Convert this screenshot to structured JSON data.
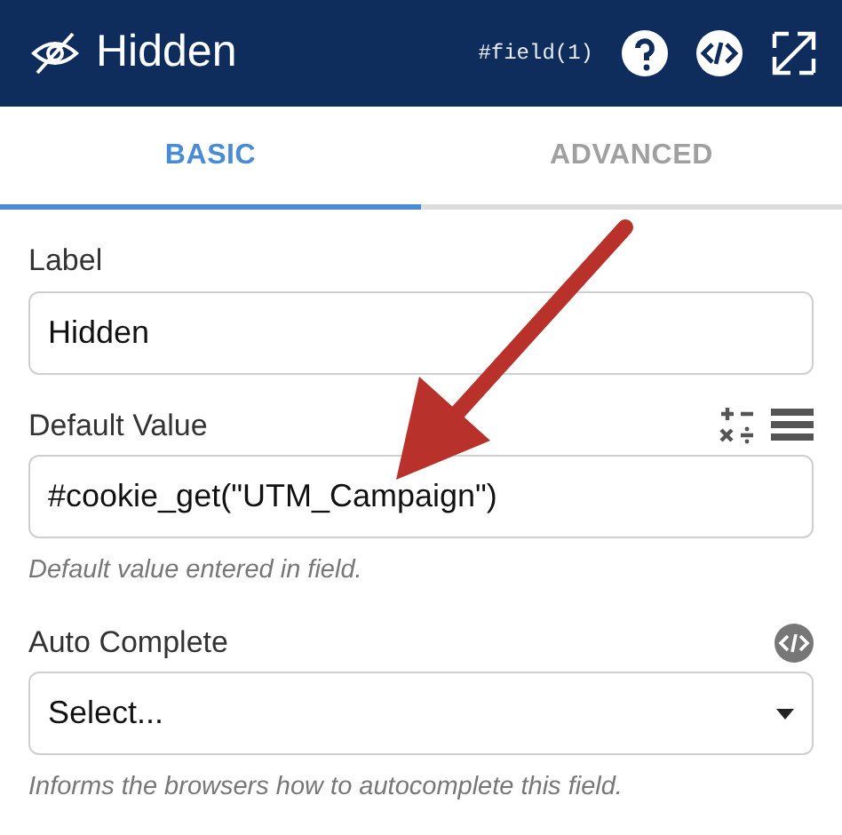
{
  "header": {
    "title": "Hidden",
    "field_ref": "#field(1)"
  },
  "tabs": [
    {
      "label": "BASIC",
      "selected": true
    },
    {
      "label": "ADVANCED",
      "selected": false
    }
  ],
  "fields": [
    {
      "kind": "text",
      "label": "Label",
      "value": "Hidden"
    },
    {
      "kind": "formula",
      "label": "Default Value",
      "value": "#cookie_get(\"UTM_Campaign\")",
      "help": "Default value entered in field."
    },
    {
      "kind": "select",
      "label": "Auto Complete",
      "value": "Select...",
      "help": "Informs the browsers how to autocomplete this field."
    }
  ],
  "annotations": [
    {
      "kind": "arrow"
    }
  ]
}
